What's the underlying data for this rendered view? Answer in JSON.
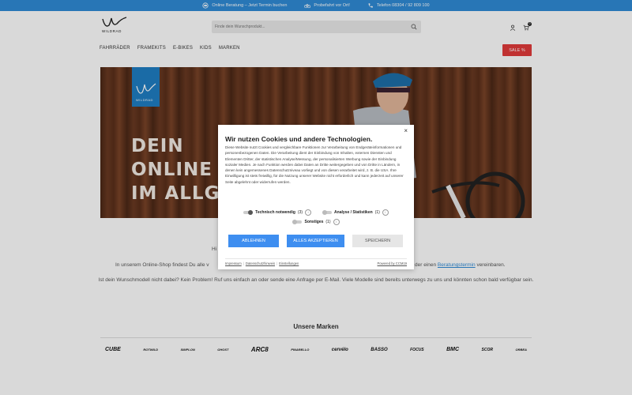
{
  "topbar": {
    "item1": "Online Beratung – Jetzt Termin buchen",
    "item2": "Probefahrt vor Ort!",
    "item3": "Telefon 08304 / 92 809 100"
  },
  "header": {
    "logo_text": "WILDRAD",
    "search_placeholder": "Finde dein Wunschprodukt...",
    "cart_count": "0"
  },
  "nav": {
    "items": [
      "FAHRRÄDER",
      "FRAMEKITS",
      "E-BIKES",
      "KIDS",
      "MARKEN"
    ],
    "sale": "SALE %"
  },
  "hero": {
    "badge_text": "WILDRAD",
    "line1": "DEIN",
    "line2": "ONLINE S",
    "line3": "IM ALLGÄ"
  },
  "content": {
    "para1_prefix": "Hi",
    "para2": "In unserem Online-Shop findest Du alle v",
    "para2_end": "der einen",
    "para2_link": "Beratungstermin",
    "para2_after": "vereinbaren.",
    "para3": "Ist dein Wunschmodell nicht dabei? Kein Problem! Ruf uns einfach an oder sende eine Anfrage per E-Mail. Viele Modelle sind bereits unterwegs zu uns und könnten schon bald verfügbar sein."
  },
  "brands": {
    "title": "Unsere Marken",
    "items": [
      "CUBE",
      "ROTWILD",
      "SIMPLON",
      "GHOST",
      "ARC8",
      "PINARELLO",
      "cervélo",
      "BASSO",
      "FOCUS",
      "BMC",
      "SCOR",
      "ORBEA"
    ]
  },
  "cookie": {
    "title": "Wir nutzen Cookies und andere Technologien.",
    "body": "Diese Website nutzt Cookies und vergleichbare Funktionen zur Verarbeitung von Endgeräteinformationen und personenbezogenen Daten. Die Verarbeitung dient der Einbindung von Inhalten, externen Diensten und Elementen Dritter, der statistischen Analyse/Messung, der personalisierten Werbung sowie der Einbindung sozialer Medien. Je nach Funktion werden dabei Daten an Dritte weitergegeben und von Dritte in Ländern, in denen kein angemessenes Datenschutzniveau vorliegt und von diesen verarbeitet wird, z. B. die USA. Ihre Einwilligung ist stets freiwillig, für die Nutzung unserer Website nicht erforderlich und kann jederzeit auf unserer Seite abgelehnt oder widerrufen werden.",
    "toggle_technical": "Technisch notwendig",
    "toggle_technical_count": "(3)",
    "toggle_analysis": "Analyse / Statistiken",
    "toggle_analysis_count": "(1)",
    "toggle_other": "Sonstiges",
    "toggle_other_count": "(1)",
    "btn_decline": "ABLEHNEN",
    "btn_accept_all": "ALLES AKZEPTIEREN",
    "btn_save": "SPEICHERN",
    "link_imprint": "Impressum",
    "link_privacy": "Datenschutzhinweis",
    "link_settings": "Einstellungen",
    "powered": "Powered by CCM19",
    "close": "×"
  }
}
